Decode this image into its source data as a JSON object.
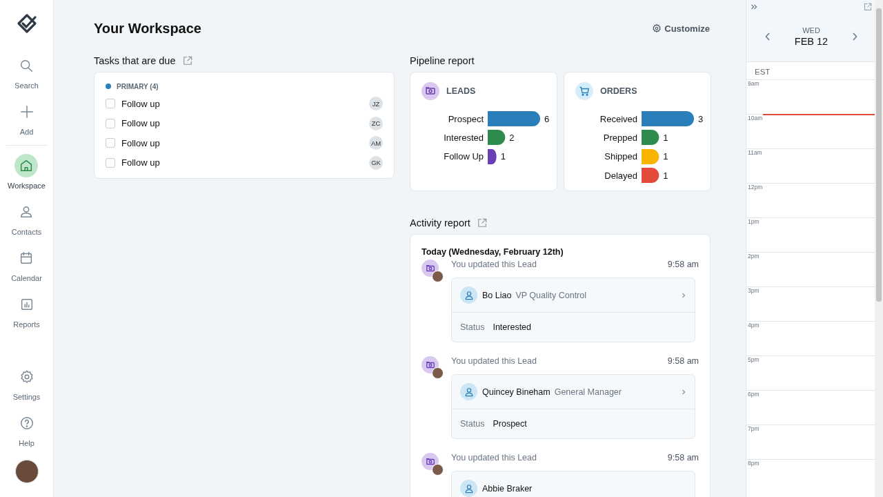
{
  "nav": {
    "top": [
      {
        "label": "Search",
        "selected": false
      },
      {
        "label": "Add",
        "selected": false
      }
    ],
    "main": [
      {
        "label": "Workspace",
        "selected": true
      },
      {
        "label": "Contacts",
        "selected": false
      },
      {
        "label": "Calendar",
        "selected": false
      },
      {
        "label": "Reports",
        "selected": false
      }
    ],
    "bottom": [
      {
        "label": "Settings",
        "selected": false
      },
      {
        "label": "Help",
        "selected": false
      }
    ]
  },
  "page": {
    "title": "Your Workspace",
    "customize": "Customize"
  },
  "tasks": {
    "title": "Tasks that are due",
    "group": {
      "label": "PRIMARY (4)",
      "color": "#2a7fba"
    },
    "items": [
      {
        "label": "Follow up",
        "checked": false,
        "assignee": "JZ"
      },
      {
        "label": "Follow up",
        "checked": false,
        "assignee": "ZC"
      },
      {
        "label": "Follow up",
        "checked": false,
        "assignee": "AM"
      },
      {
        "label": "Follow up",
        "checked": false,
        "assignee": "GK"
      }
    ]
  },
  "pipeline": {
    "title": "Pipeline report",
    "cards": [
      {
        "title": "LEADS",
        "chart_data": {
          "type": "bar",
          "orientation": "horizontal",
          "data_labels": true,
          "series": [
            {
              "name": "Prospect",
              "color": "#2a7fba",
              "values": [
                6
              ]
            },
            {
              "name": "Interested",
              "color": "#2e8b4e",
              "values": [
                2
              ]
            },
            {
              "name": "Follow Up",
              "color": "#6a3fb5",
              "values": [
                1
              ]
            }
          ]
        }
      },
      {
        "title": "ORDERS",
        "chart_data": {
          "type": "bar",
          "orientation": "horizontal",
          "data_labels": true,
          "series": [
            {
              "name": "Received",
              "color": "#2a7fba",
              "values": [
                3
              ]
            },
            {
              "name": "Prepped",
              "color": "#2e8b4e",
              "values": [
                1
              ]
            },
            {
              "name": "Shipped",
              "color": "#f7b500",
              "values": [
                1
              ]
            },
            {
              "name": "Delayed",
              "color": "#e24b3b",
              "values": [
                1
              ]
            }
          ]
        }
      }
    ]
  },
  "activity": {
    "title": "Activity report",
    "day": "Today (Wednesday, February 12th)",
    "entries": [
      {
        "text": "You updated this Lead",
        "time": "9:58 am",
        "name": "Bo Liao",
        "role": "VP Quality Control",
        "status_label": "Status",
        "status": "Interested"
      },
      {
        "text": "You updated this Lead",
        "time": "9:58 am",
        "name": "Quincey Bineham",
        "role": "General Manager",
        "status_label": "Status",
        "status": "Prospect"
      },
      {
        "text": "You updated this Lead",
        "time": "9:58 am",
        "name": "Abbie Braker"
      }
    ]
  },
  "calendar": {
    "weekday": "WED",
    "date": "FEB 12",
    "timezone": "EST",
    "hours": [
      {
        "label": "9am",
        "now": false
      },
      {
        "label": "10am",
        "now": true
      },
      {
        "label": "11am",
        "now": false
      },
      {
        "label": "12pm",
        "now": false
      },
      {
        "label": "1pm",
        "now": false
      },
      {
        "label": "2pm",
        "now": false
      },
      {
        "label": "3pm",
        "now": false
      },
      {
        "label": "4pm",
        "now": false
      },
      {
        "label": "5pm",
        "now": false
      },
      {
        "label": "6pm",
        "now": false
      },
      {
        "label": "7pm",
        "now": false
      },
      {
        "label": "8pm",
        "now": false
      }
    ]
  }
}
